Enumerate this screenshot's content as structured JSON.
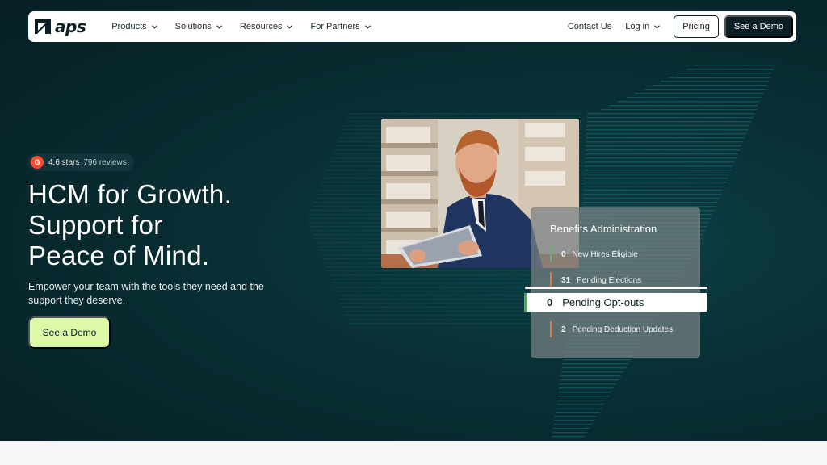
{
  "nav": {
    "logo_text": "aps",
    "items": [
      {
        "label": "Products"
      },
      {
        "label": "Solutions"
      },
      {
        "label": "Resources"
      },
      {
        "label": "For Partners"
      }
    ],
    "contact": "Contact Us",
    "login": "Log in",
    "pricing": "Pricing",
    "demo": "See a Demo"
  },
  "hero": {
    "rating_badge": "G",
    "rating_stars": "4.6 stars",
    "rating_reviews": "796 reviews",
    "headline": [
      "HCM for Growth.",
      "Support for",
      "Peace of Mind."
    ],
    "subtext": "Empower your team with the tools they need and the support they deserve.",
    "cta": "See a Demo"
  },
  "card": {
    "title": "Benefits Administration",
    "rows": [
      {
        "num": "0",
        "label": "New Hires Eligible",
        "color": "#6db36d"
      },
      {
        "num": "31",
        "label": "Pending Elections",
        "color": "#e67a3a"
      },
      {
        "num": "2",
        "label": "Pending Deduction Updates",
        "color": "#e67a3a"
      }
    ],
    "highlight": {
      "num": "0",
      "label": "Pending Opt-outs",
      "color": "#5fa05f"
    }
  },
  "colors": {
    "hero_bg": "#082e33",
    "accent_green": "#dcf9a8",
    "dark": "#0b1f24",
    "g2_red": "#ff492c"
  }
}
